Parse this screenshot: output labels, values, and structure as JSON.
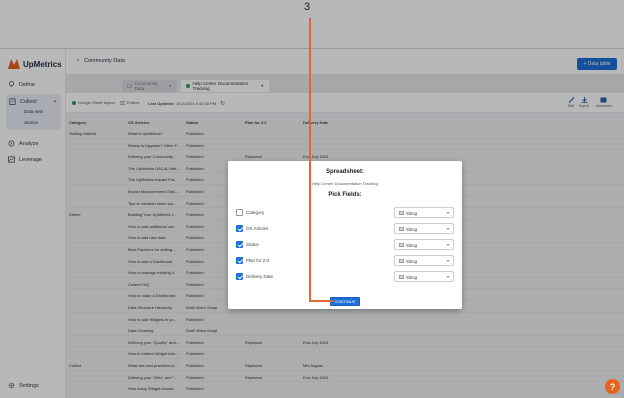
{
  "annotation": {
    "step_number": "3"
  },
  "sidebar": {
    "brand": "UpMetrics",
    "items": [
      {
        "label": "Define",
        "icon": "lightbulb-icon"
      },
      {
        "label": "Collect",
        "icon": "clipboard-icon"
      },
      {
        "label": "Analyze",
        "icon": "compass-icon"
      },
      {
        "label": "Leverage",
        "icon": "chart-icon"
      },
      {
        "label": "Settings",
        "icon": "gear-icon"
      }
    ],
    "subitems": [
      "Data sets",
      "Stories"
    ]
  },
  "header": {
    "back_glyph": "‹",
    "title": "Community Data",
    "data_table_button": "+ Data table"
  },
  "tabs": {
    "inactive": "Community Data",
    "active": "Help Center Documentation Tracking"
  },
  "toolbar": {
    "source": "Google Sheet Import",
    "entries": "Entries",
    "last_updated_label": "Last Updated:",
    "last_updated_value": "6/13/2024 4:42:38 PM",
    "actions": [
      "Edit",
      "Export",
      "Advanced"
    ]
  },
  "table": {
    "columns": [
      "Category",
      "OS Articles",
      "Status",
      "Plan for 2.0",
      "Delivery Date"
    ],
    "rows": [
      [
        "Getting Started",
        "What is UpMetrics?",
        "Published",
        "",
        ""
      ],
      [
        "",
        "Ready to Upgrade? Other F...",
        "Published",
        "",
        ""
      ],
      [
        "",
        "Defining your Community ...",
        "Published",
        "Replaced",
        "End July 2024"
      ],
      [
        "",
        "The UpMetrics DACAL Met...",
        "Published",
        "",
        ""
      ],
      [
        "",
        "The UpMetrics Impact Fra...",
        "Published",
        "",
        ""
      ],
      [
        "",
        "Impact Measurement Glos...",
        "Published",
        "",
        ""
      ],
      [
        "",
        "Tips to consider when usi...",
        "Published",
        "",
        ""
      ],
      [
        "Define",
        "Building Your UpMetrics I...",
        "Published",
        "",
        ""
      ],
      [
        "",
        "How to add additional use...",
        "Published",
        "",
        ""
      ],
      [
        "",
        "How to add new data",
        "Published",
        "",
        ""
      ],
      [
        "",
        "Best Practices for setting...",
        "Published",
        "",
        ""
      ],
      [
        "",
        "How to add a Dashboard",
        "Published",
        "",
        ""
      ],
      [
        "",
        "How to manage existing li...",
        "Published",
        "",
        ""
      ],
      [
        "",
        "Collect FAQ",
        "Published",
        "",
        ""
      ],
      [
        "",
        "How to make a Dashboard",
        "Published",
        "",
        ""
      ],
      [
        "",
        "Data Structure Hierarchy",
        "Draft Video Script",
        "",
        ""
      ],
      [
        "",
        "How to add Widgets to yo...",
        "Published",
        "",
        ""
      ],
      [
        "",
        "Data Cleaning",
        "Draft Video Script",
        "",
        ""
      ],
      [
        "",
        "Defining your \"Quality\" and...",
        "Published",
        "Replaced",
        "End July 2024"
      ],
      [
        "",
        "How to embed Widget into...",
        "Published",
        "",
        ""
      ],
      [
        "Collect",
        "What are best practices to...",
        "Published",
        "Replaced",
        "Mid August"
      ],
      [
        "",
        "Defining your \"Who\" and \"...",
        "Published",
        "Replaced",
        "End July 2024"
      ],
      [
        "",
        "How many Widget should...",
        "Published",
        "",
        ""
      ]
    ]
  },
  "modal": {
    "heading": "Spreadsheet:",
    "spreadsheet_name": "Help Center Documentation Tracking",
    "pick_fields_heading": "Pick Fields:",
    "fields": [
      {
        "label": "Category",
        "checked": false,
        "type": "String"
      },
      {
        "label": "OS Articles",
        "checked": true,
        "type": "String"
      },
      {
        "label": "Status",
        "checked": true,
        "type": "String"
      },
      {
        "label": "Plan for 2.0",
        "checked": true,
        "type": "String"
      },
      {
        "label": "Delivery Date",
        "checked": true,
        "type": "String"
      }
    ],
    "continue_label": "CONTINUE"
  },
  "help_button": "?",
  "colors": {
    "primary": "#1e6fd9",
    "annotation": "#e0653a",
    "help": "#e8641e",
    "active_tab_dot": "#2e9e5b"
  }
}
